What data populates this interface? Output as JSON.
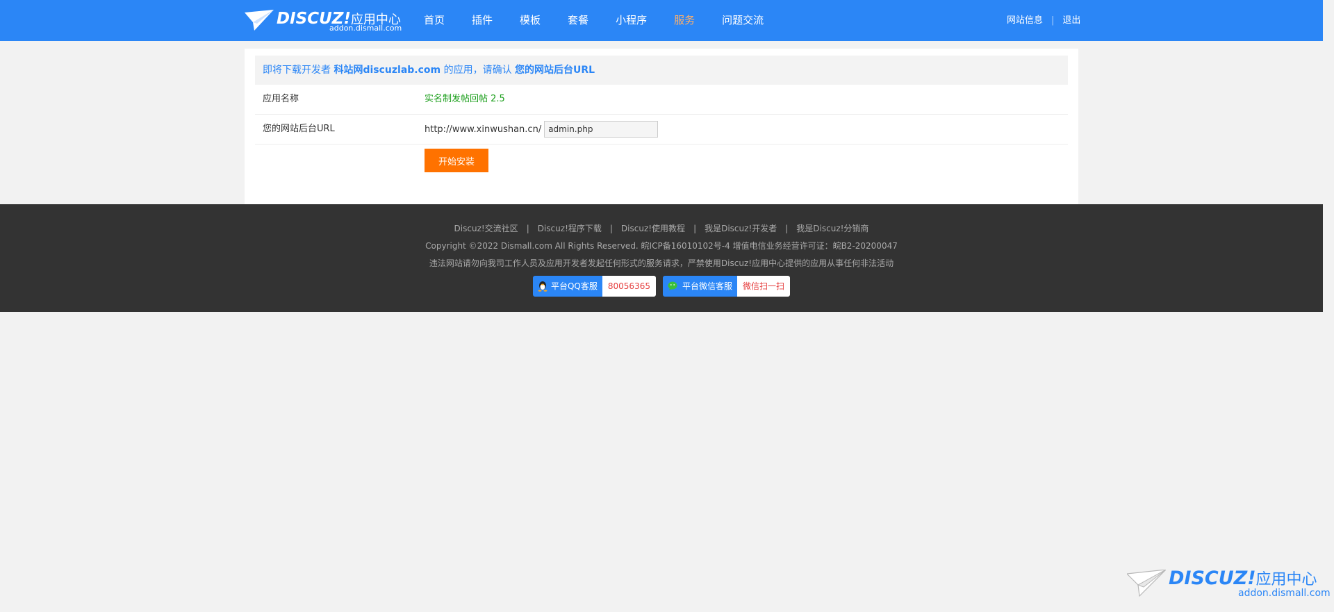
{
  "header": {
    "logo_title": "DISCUZ!",
    "logo_cn": "应用中心",
    "logo_sub": "addon.dismall.com",
    "nav": [
      {
        "label": "首页",
        "active": false
      },
      {
        "label": "插件",
        "active": false
      },
      {
        "label": "模板",
        "active": false
      },
      {
        "label": "套餐",
        "active": false
      },
      {
        "label": "小程序",
        "active": false
      },
      {
        "label": "服务",
        "active": true
      },
      {
        "label": "问题交流",
        "active": false
      }
    ],
    "site_info": "网站信息",
    "separator": "|",
    "logout": "退出"
  },
  "notice": {
    "prefix": "即将下载开发者",
    "developer": "科站网discuzlab.com",
    "middle": "的应用，请确认",
    "target": "您的网站后台URL"
  },
  "form": {
    "app_name_label": "应用名称",
    "app_name_value": "实名制发帖回帖 2.5",
    "url_label": "您的网站后台URL",
    "url_prefix": "http://www.xinwushan.cn/",
    "url_input_value": "admin.php",
    "install_button": "开始安装"
  },
  "footer": {
    "links": [
      "Discuz!交流社区",
      "Discuz!程序下载",
      "Discuz!使用教程",
      "我是Discuz!开发者",
      "我是Discuz!分销商"
    ],
    "separator": "|",
    "copyright": "Copyright ©2022 Dismall.com All Rights Reserved.  皖ICP备16010102号-4  增值电信业务经营许可证：皖B2-20200047",
    "warning": "违法网站请勿向我司工作人员及应用开发者发起任何形式的服务请求，严禁使用Discuz!应用中心提供的应用从事任何非法活动",
    "qq_label": "平台QQ客服",
    "qq_value": "80056365",
    "wechat_label": "平台微信客服",
    "wechat_value": "微信扫一扫"
  },
  "corner_logo": {
    "title": "DISCUZ!",
    "cn": "应用中心",
    "sub": "addon.dismall.com"
  },
  "colors": {
    "brand_blue": "#2b86f6",
    "active_nav": "#ffb069",
    "install_orange": "#ff7200",
    "app_name_green": "#1a9e1a",
    "footer_bg": "#333333"
  },
  "icons": [
    "paper-plane-logo-icon",
    "qq-penguin-icon",
    "wechat-icon"
  ]
}
